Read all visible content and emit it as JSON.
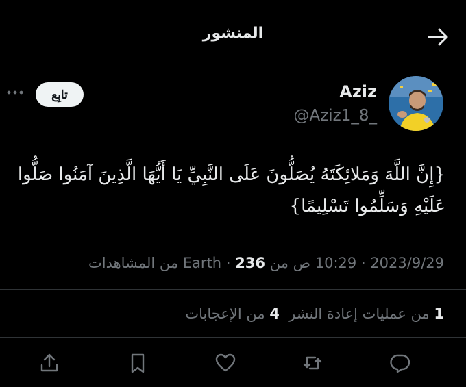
{
  "header": {
    "title": "المنشور",
    "back_icon": "arrow-right-icon"
  },
  "author": {
    "display_name": "Aziz",
    "handle": "@Aziz1_8_",
    "avatar": "profile-photo"
  },
  "follow_button": {
    "label": "تابِع"
  },
  "post": {
    "text": "{إِنَّ اللَّهَ وَمَلائِكَتَهُ يُصَلُّونَ عَلَى النَّبِيِّ يَا أَيُّهَا الَّذِينَ آمَنُوا صَلُّوا عَلَيْهِ وَسَلِّمُوا تَسْلِيمًا}"
  },
  "meta": {
    "date": "2023/9/29",
    "time": "10:29 ص",
    "location": "من Earth",
    "separator": "·",
    "views_count": "236",
    "views_label": "من المشاهدات"
  },
  "stats": {
    "reposts_count": "1",
    "reposts_label": "من عمليات إعادة النشر",
    "likes_count": "4",
    "likes_label": "من الإعجابات"
  },
  "actions": [
    "reply-icon",
    "repost-icon",
    "like-icon",
    "bookmark-icon",
    "share-icon"
  ],
  "colors": {
    "background": "#000000",
    "text": "#e7e9ea",
    "secondary": "#71767b",
    "divider": "#2f3336",
    "button_bg": "#eff3f4"
  }
}
